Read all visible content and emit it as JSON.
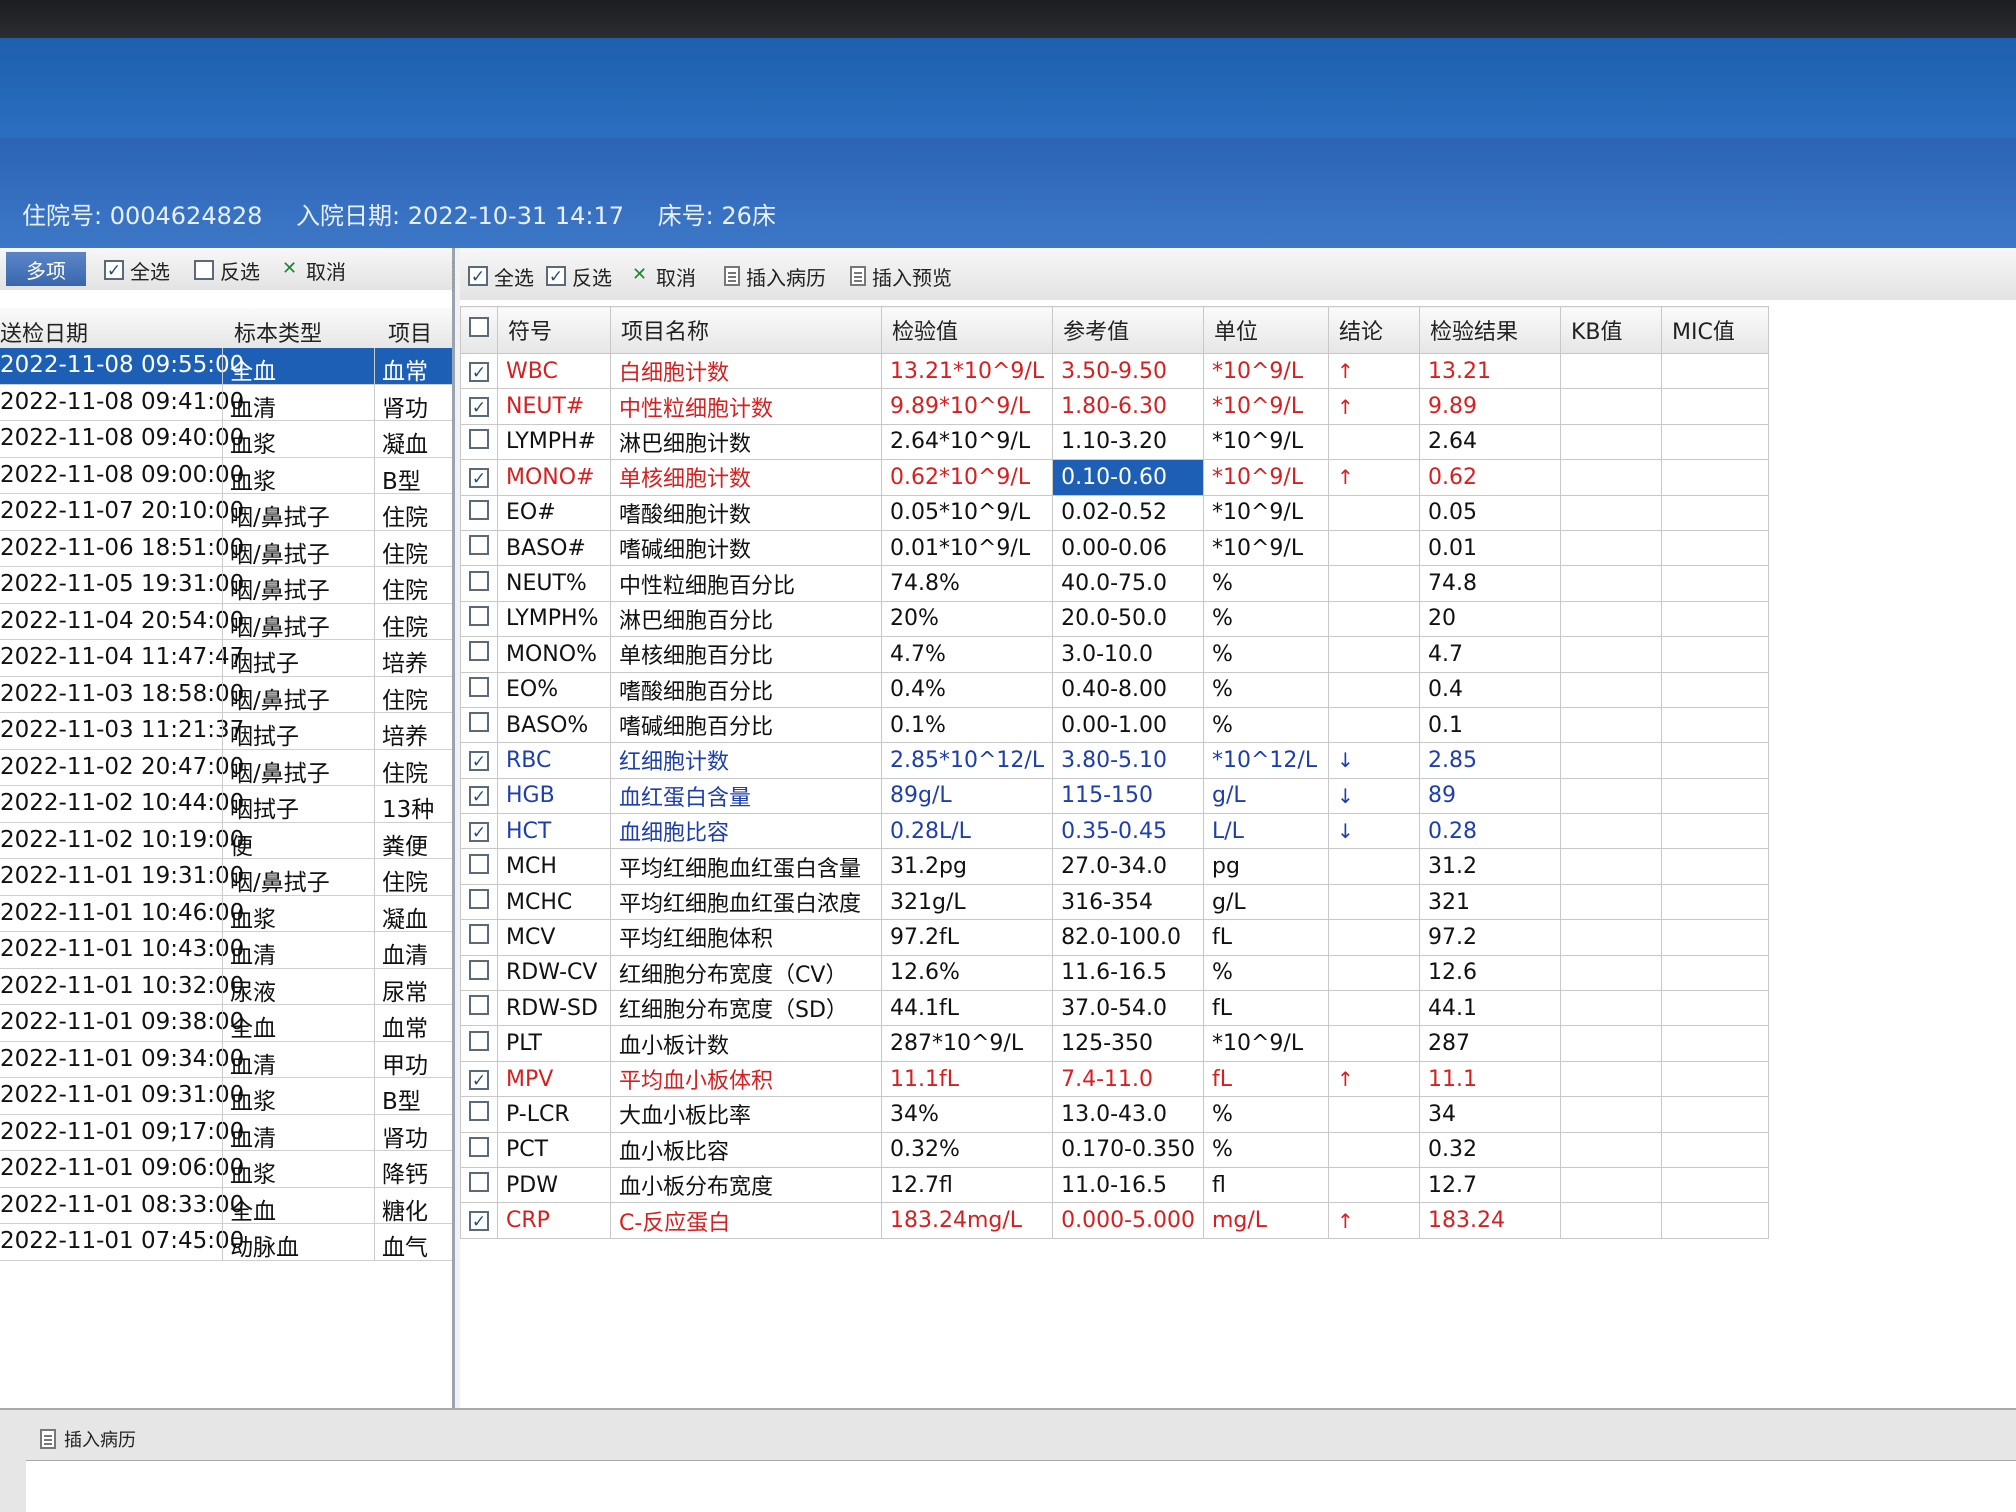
{
  "header": {
    "admission_no": "住院号: 0004624828",
    "admission_date": "入院日期: 2022-10-31 14:17",
    "bed_no": "床号: 26床"
  },
  "left_toolbar": {
    "multi_label": "多项",
    "select_all": "全选",
    "invert": "反选",
    "cancel": "取消"
  },
  "left_columns": {
    "date": "送检日期",
    "specimen": "标本类型",
    "item": "项目"
  },
  "left_rows": [
    {
      "date": "2022-11-08 09:55:00",
      "specimen": "全血",
      "item": "血常"
    },
    {
      "date": "2022-11-08 09:41:00",
      "specimen": "血清",
      "item": "肾功"
    },
    {
      "date": "2022-11-08 09:40:00",
      "specimen": "血浆",
      "item": "凝血"
    },
    {
      "date": "2022-11-08 09:00:00",
      "specimen": "血浆",
      "item": "B型"
    },
    {
      "date": "2022-11-07 20:10:00",
      "specimen": "咽/鼻拭子",
      "item": "住院"
    },
    {
      "date": "2022-11-06 18:51:00",
      "specimen": "咽/鼻拭子",
      "item": "住院"
    },
    {
      "date": "2022-11-05 19:31:00",
      "specimen": "咽/鼻拭子",
      "item": "住院"
    },
    {
      "date": "2022-11-04 20:54:00",
      "specimen": "咽/鼻拭子",
      "item": "住院"
    },
    {
      "date": "2022-11-04 11:47:47",
      "specimen": "咽拭子",
      "item": "培养"
    },
    {
      "date": "2022-11-03 18:58:00",
      "specimen": "咽/鼻拭子",
      "item": "住院"
    },
    {
      "date": "2022-11-03 11:21:37",
      "specimen": "咽拭子",
      "item": "培养"
    },
    {
      "date": "2022-11-02 20:47:00",
      "specimen": "咽/鼻拭子",
      "item": "住院"
    },
    {
      "date": "2022-11-02 10:44:00",
      "specimen": "咽拭子",
      "item": "13种"
    },
    {
      "date": "2022-11-02 10:19:00",
      "specimen": "便",
      "item": "粪便"
    },
    {
      "date": "2022-11-01 19:31:00",
      "specimen": "咽/鼻拭子",
      "item": "住院"
    },
    {
      "date": "2022-11-01 10:46:00",
      "specimen": "血浆",
      "item": "凝血"
    },
    {
      "date": "2022-11-01 10:43:00",
      "specimen": "血清",
      "item": "血清"
    },
    {
      "date": "2022-11-01 10:32:00",
      "specimen": "尿液",
      "item": "尿常"
    },
    {
      "date": "2022-11-01 09:38:00",
      "specimen": "全血",
      "item": "血常"
    },
    {
      "date": "2022-11-01 09:34:00",
      "specimen": "血清",
      "item": "甲功"
    },
    {
      "date": "2022-11-01 09:31:00",
      "specimen": "血浆",
      "item": "B型"
    },
    {
      "date": "2022-11-01 09;17:00",
      "specimen": "血清",
      "item": "肾功"
    },
    {
      "date": "2022-11-01 09:06:00",
      "specimen": "血浆",
      "item": "降钙"
    },
    {
      "date": "2022-11-01 08:33:00",
      "specimen": "全血",
      "item": "糖化"
    },
    {
      "date": "2022-11-01 07:45:00",
      "specimen": "动脉血",
      "item": "血气"
    }
  ],
  "right_toolbar": {
    "select_all": "全选",
    "invert": "反选",
    "cancel": "取消",
    "insert_record": "插入病历",
    "insert_preview": "插入预览"
  },
  "result_columns": {
    "symbol": "符号",
    "name": "项目名称",
    "value": "检验值",
    "reference": "参考值",
    "unit": "单位",
    "conclusion": "结论",
    "result": "检验结果",
    "kb": "KB值",
    "mic": "MIC值"
  },
  "results": [
    {
      "checked": true,
      "flag": "high",
      "symbol": "WBC",
      "name": "白细胞计数",
      "value": "13.21*10^9/L",
      "reference": "3.50-9.50",
      "unit": "*10^9/L",
      "conclusion": "↑",
      "result": "13.21"
    },
    {
      "checked": true,
      "flag": "high",
      "symbol": "NEUT#",
      "name": "中性粒细胞计数",
      "value": "9.89*10^9/L",
      "reference": "1.80-6.30",
      "unit": "*10^9/L",
      "conclusion": "↑",
      "result": "9.89"
    },
    {
      "checked": false,
      "flag": "normal",
      "symbol": "LYMPH#",
      "name": "淋巴细胞计数",
      "value": "2.64*10^9/L",
      "reference": "1.10-3.20",
      "unit": "*10^9/L",
      "conclusion": "",
      "result": "2.64"
    },
    {
      "checked": true,
      "flag": "high",
      "symbol": "MONO#",
      "name": "单核细胞计数",
      "value": "0.62*10^9/L",
      "reference": "0.10-0.60",
      "unit": "*10^9/L",
      "conclusion": "↑",
      "result": "0.62"
    },
    {
      "checked": false,
      "flag": "normal",
      "symbol": "EO#",
      "name": "嗜酸细胞计数",
      "value": "0.05*10^9/L",
      "reference": "0.02-0.52",
      "unit": "*10^9/L",
      "conclusion": "",
      "result": "0.05"
    },
    {
      "checked": false,
      "flag": "normal",
      "symbol": "BASO#",
      "name": "嗜碱细胞计数",
      "value": "0.01*10^9/L",
      "reference": "0.00-0.06",
      "unit": "*10^9/L",
      "conclusion": "",
      "result": "0.01"
    },
    {
      "checked": false,
      "flag": "normal",
      "symbol": "NEUT%",
      "name": "中性粒细胞百分比",
      "value": "74.8%",
      "reference": "40.0-75.0",
      "unit": "%",
      "conclusion": "",
      "result": "74.8"
    },
    {
      "checked": false,
      "flag": "normal",
      "symbol": "LYMPH%",
      "name": "淋巴细胞百分比",
      "value": "20%",
      "reference": "20.0-50.0",
      "unit": "%",
      "conclusion": "",
      "result": "20"
    },
    {
      "checked": false,
      "flag": "normal",
      "symbol": "MONO%",
      "name": "单核细胞百分比",
      "value": "4.7%",
      "reference": "3.0-10.0",
      "unit": "%",
      "conclusion": "",
      "result": "4.7"
    },
    {
      "checked": false,
      "flag": "normal",
      "symbol": "EO%",
      "name": "嗜酸细胞百分比",
      "value": "0.4%",
      "reference": "0.40-8.00",
      "unit": "%",
      "conclusion": "",
      "result": "0.4"
    },
    {
      "checked": false,
      "flag": "normal",
      "symbol": "BASO%",
      "name": "嗜碱细胞百分比",
      "value": "0.1%",
      "reference": "0.00-1.00",
      "unit": "%",
      "conclusion": "",
      "result": "0.1"
    },
    {
      "checked": true,
      "flag": "low",
      "symbol": "RBC",
      "name": "红细胞计数",
      "value": "2.85*10^12/L",
      "reference": "3.80-5.10",
      "unit": "*10^12/L",
      "conclusion": "↓",
      "result": "2.85"
    },
    {
      "checked": true,
      "flag": "low",
      "symbol": "HGB",
      "name": "血红蛋白含量",
      "value": "89g/L",
      "reference": "115-150",
      "unit": "g/L",
      "conclusion": "↓",
      "result": "89"
    },
    {
      "checked": true,
      "flag": "low",
      "symbol": "HCT",
      "name": "血细胞比容",
      "value": "0.28L/L",
      "reference": "0.35-0.45",
      "unit": "L/L",
      "conclusion": "↓",
      "result": "0.28"
    },
    {
      "checked": false,
      "flag": "normal",
      "symbol": "MCH",
      "name": "平均红细胞血红蛋白含量",
      "value": "31.2pg",
      "reference": "27.0-34.0",
      "unit": "pg",
      "conclusion": "",
      "result": "31.2"
    },
    {
      "checked": false,
      "flag": "normal",
      "symbol": "MCHC",
      "name": "平均红细胞血红蛋白浓度",
      "value": "321g/L",
      "reference": "316-354",
      "unit": "g/L",
      "conclusion": "",
      "result": "321"
    },
    {
      "checked": false,
      "flag": "normal",
      "symbol": "MCV",
      "name": "平均红细胞体积",
      "value": "97.2fL",
      "reference": "82.0-100.0",
      "unit": "fL",
      "conclusion": "",
      "result": "97.2"
    },
    {
      "checked": false,
      "flag": "normal",
      "symbol": "RDW-CV",
      "name": "红细胞分布宽度（CV）",
      "value": "12.6%",
      "reference": "11.6-16.5",
      "unit": "%",
      "conclusion": "",
      "result": "12.6"
    },
    {
      "checked": false,
      "flag": "normal",
      "symbol": "RDW-SD",
      "name": "红细胞分布宽度（SD）",
      "value": "44.1fL",
      "reference": "37.0-54.0",
      "unit": "fL",
      "conclusion": "",
      "result": "44.1"
    },
    {
      "checked": false,
      "flag": "normal",
      "symbol": "PLT",
      "name": "血小板计数",
      "value": "287*10^9/L",
      "reference": "125-350",
      "unit": "*10^9/L",
      "conclusion": "",
      "result": "287"
    },
    {
      "checked": true,
      "flag": "high",
      "symbol": "MPV",
      "name": "平均血小板体积",
      "value": "11.1fL",
      "reference": "7.4-11.0",
      "unit": "fL",
      "conclusion": "↑",
      "result": "11.1"
    },
    {
      "checked": false,
      "flag": "normal",
      "symbol": "P-LCR",
      "name": "大血小板比率",
      "value": "34%",
      "reference": "13.0-43.0",
      "unit": "%",
      "conclusion": "",
      "result": "34"
    },
    {
      "checked": false,
      "flag": "normal",
      "symbol": "PCT",
      "name": "血小板比容",
      "value": "0.32%",
      "reference": "0.170-0.350",
      "unit": "%",
      "conclusion": "",
      "result": "0.32"
    },
    {
      "checked": false,
      "flag": "normal",
      "symbol": "PDW",
      "name": "血小板分布宽度",
      "value": "12.7fl",
      "reference": "11.0-16.5",
      "unit": "fl",
      "conclusion": "",
      "result": "12.7"
    },
    {
      "checked": true,
      "flag": "high",
      "symbol": "CRP",
      "name": "C-反应蛋白",
      "value": "183.24mg/L",
      "reference": "0.000-5.000",
      "unit": "mg/L",
      "conclusion": "↑",
      "result": "183.24"
    }
  ],
  "bottom_toolbar": {
    "insert_record": "插入病历"
  },
  "colors": {
    "high": "#d42020",
    "low": "#1f3fa8",
    "selection": "#1d5fb4",
    "title_bar": "#2a6fc0"
  }
}
